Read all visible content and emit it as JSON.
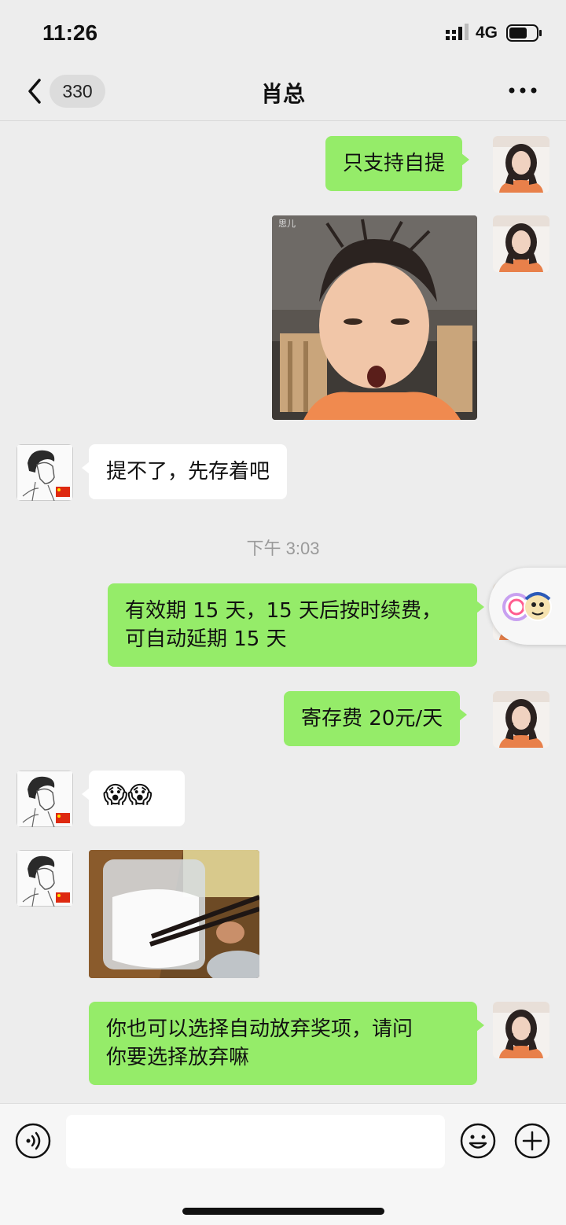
{
  "status_bar": {
    "time": "11:26",
    "network": "4G"
  },
  "header": {
    "back_icon": "chevron-left-icon",
    "unread_count": "330",
    "title": "肖总",
    "more_icon": "more-icon"
  },
  "messages": [
    {
      "side": "right",
      "type": "text",
      "text": "只支持自提"
    },
    {
      "side": "right",
      "type": "image",
      "image_label": "思儿"
    },
    {
      "side": "left",
      "type": "text",
      "text": "提不了，先存着吧"
    },
    {
      "type": "timestamp",
      "text": "下午 3:03"
    },
    {
      "side": "right",
      "type": "text",
      "line1": "有效期 15 天，15 天后按时续费，",
      "line2": "可自动延期 15 天"
    },
    {
      "side": "right",
      "type": "text",
      "text": "寄存费 20元/天"
    },
    {
      "side": "left",
      "type": "emoji",
      "emoji": "😱😱"
    },
    {
      "side": "left",
      "type": "image"
    },
    {
      "side": "right",
      "type": "text",
      "line1": "你也可以选择自动放弃奖项，请问",
      "line2": "你要选择放弃嘛"
    }
  ],
  "input_bar": {
    "voice_icon": "voice-icon",
    "emoji_icon": "emoji-icon",
    "plus_icon": "plus-icon",
    "input_value": ""
  },
  "colors": {
    "sent_bubble": "#95ec69",
    "received_bubble": "#ffffff",
    "background": "#ededed"
  }
}
